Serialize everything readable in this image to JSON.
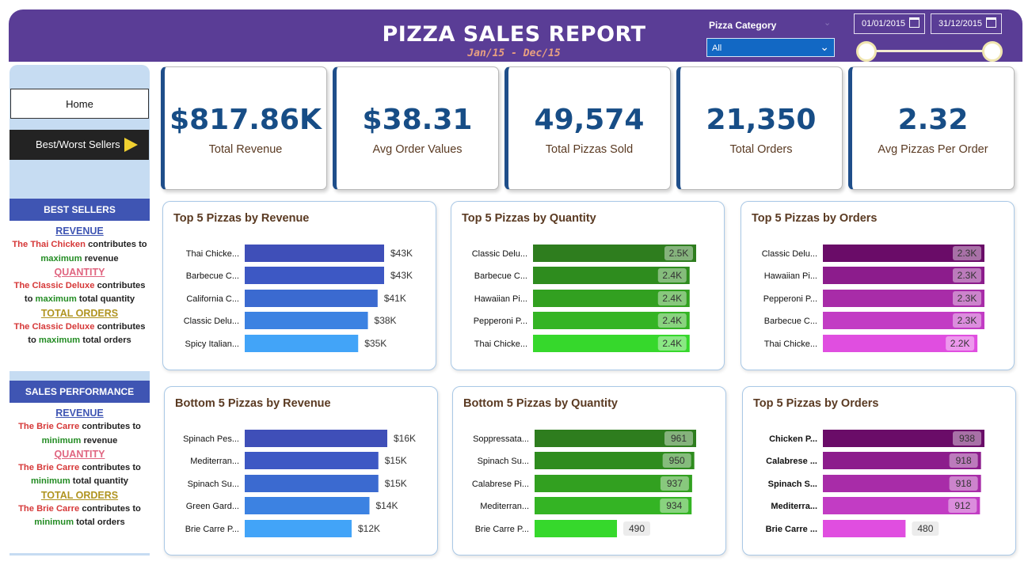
{
  "header": {
    "title": "PIZZA SALES REPORT",
    "subtitle": "Jan/15 - Dec/15",
    "category_label": "Pizza Category",
    "category_value": "All",
    "date_start": "01/01/2015",
    "date_end": "31/12/2015"
  },
  "sidebar": {
    "home_label": "Home",
    "best_worst_label": "Best/Worst Sellers",
    "best_sellers": {
      "heading": "BEST SELLERS",
      "revenue_head": "REVENUE",
      "revenue_name": "The Thai Chicken",
      "revenue_text1": "contributes to",
      "revenue_highlight": "maximum",
      "revenue_text2": "revenue",
      "quantity_head": "QUANTITY",
      "quantity_name": "The Classic Deluxe",
      "quantity_text1": "contributes",
      "quantity_pre": "to",
      "quantity_highlight": "maximum",
      "quantity_text2": "total quantity",
      "orders_head": "TOTAL ORDERS",
      "orders_name": "The Classic Deluxe",
      "orders_text1": "contributes",
      "orders_pre": "to",
      "orders_highlight": "maximum",
      "orders_text2": "total orders"
    },
    "sales_performance": {
      "heading": "SALES PERFORMANCE",
      "revenue_head": "REVENUE",
      "revenue_name": "The Brie Carre",
      "revenue_text1": "contributes to",
      "revenue_highlight": "minimum",
      "revenue_text2": "revenue",
      "quantity_head": "QUANTITY",
      "quantity_name": "The Brie Carre",
      "quantity_text1": "contributes to",
      "quantity_highlight": "minimum",
      "quantity_text2": "total quantity",
      "orders_head": "TOTAL ORDERS",
      "orders_name": "The Brie Carre",
      "orders_text1": "contributes to",
      "orders_highlight": "minimum",
      "orders_text2": "total orders"
    }
  },
  "kpis": [
    {
      "value": "$817.86K",
      "label": "Total Revenue"
    },
    {
      "value": "$38.31",
      "label": "Avg Order Values"
    },
    {
      "value": "49,574",
      "label": "Total Pizzas Sold"
    },
    {
      "value": "21,350",
      "label": "Total Orders"
    },
    {
      "value": "2.32",
      "label": "Avg Pizzas Per Order"
    }
  ],
  "colors": {
    "header_bg": "#5a3d96",
    "revenue_bars": [
      "#3f4fb8",
      "#3d58c4",
      "#3b6ad0",
      "#3c82e2",
      "#42a4f8"
    ],
    "quantity_bars": [
      "#2e7d1e",
      "#2e8c1e",
      "#32a020",
      "#34b424",
      "#36d82c"
    ],
    "orders_bars": [
      "#6a0c68",
      "#8c1c8c",
      "#a82ca8",
      "#c23cc4",
      "#e04ee0"
    ],
    "kpi_value": "#174d86"
  },
  "chart_data": [
    {
      "type": "bar",
      "title": "Top 5 Pizzas by Revenue",
      "categories": [
        "Thai Chicke...",
        "Barbecue C...",
        "California C...",
        "Classic Delu...",
        "Spicy Italian..."
      ],
      "values": [
        43,
        43,
        41,
        38,
        35
      ],
      "labels": [
        "$43K",
        "$43K",
        "$41K",
        "$38K",
        "$35K"
      ],
      "xlim": [
        0,
        43
      ]
    },
    {
      "type": "bar",
      "title": "Top 5 Pizzas by Quantity",
      "categories": [
        "Classic Delu...",
        "Barbecue C...",
        "Hawaiian Pi...",
        "Pepperoni P...",
        "Thai Chicke..."
      ],
      "values": [
        2.5,
        2.4,
        2.4,
        2.4,
        2.4
      ],
      "labels": [
        "2.5K",
        "2.4K",
        "2.4K",
        "2.4K",
        "2.4K"
      ],
      "xlim": [
        0,
        2.5
      ]
    },
    {
      "type": "bar",
      "title": "Top 5 Pizzas by Orders",
      "categories": [
        "Classic Delu...",
        "Hawaiian Pi...",
        "Pepperoni P...",
        "Barbecue C...",
        "Thai Chicke..."
      ],
      "values": [
        2.3,
        2.3,
        2.3,
        2.3,
        2.2
      ],
      "labels": [
        "2.3K",
        "2.3K",
        "2.3K",
        "2.3K",
        "2.2K"
      ],
      "xlim": [
        0,
        2.3
      ]
    },
    {
      "type": "bar",
      "title": "Bottom 5 Pizzas by Revenue",
      "categories": [
        "Spinach Pes...",
        "Mediterran...",
        "Spinach Su...",
        "Green Gard...",
        "Brie Carre P..."
      ],
      "values": [
        16,
        15,
        15,
        14,
        12
      ],
      "labels": [
        "$16K",
        "$15K",
        "$15K",
        "$14K",
        "$12K"
      ],
      "xlim": [
        0,
        16
      ]
    },
    {
      "type": "bar",
      "title": "Bottom 5 Pizzas by Quantity",
      "categories": [
        "Soppressata...",
        "Spinach Su...",
        "Calabrese Pi...",
        "Mediterran...",
        "Brie Carre P..."
      ],
      "values": [
        961,
        950,
        937,
        934,
        490
      ],
      "labels": [
        "961",
        "950",
        "937",
        "934",
        "490"
      ],
      "xlim": [
        0,
        961
      ]
    },
    {
      "type": "bar",
      "title": "Top 5 Pizzas by Orders",
      "categories": [
        "Chicken P...",
        "Calabrese ...",
        "Spinach S...",
        "Mediterra...",
        "Brie Carre ..."
      ],
      "values": [
        938,
        918,
        918,
        912,
        480
      ],
      "labels": [
        "938",
        "918",
        "918",
        "912",
        "480"
      ],
      "xlim": [
        0,
        938
      ]
    }
  ]
}
